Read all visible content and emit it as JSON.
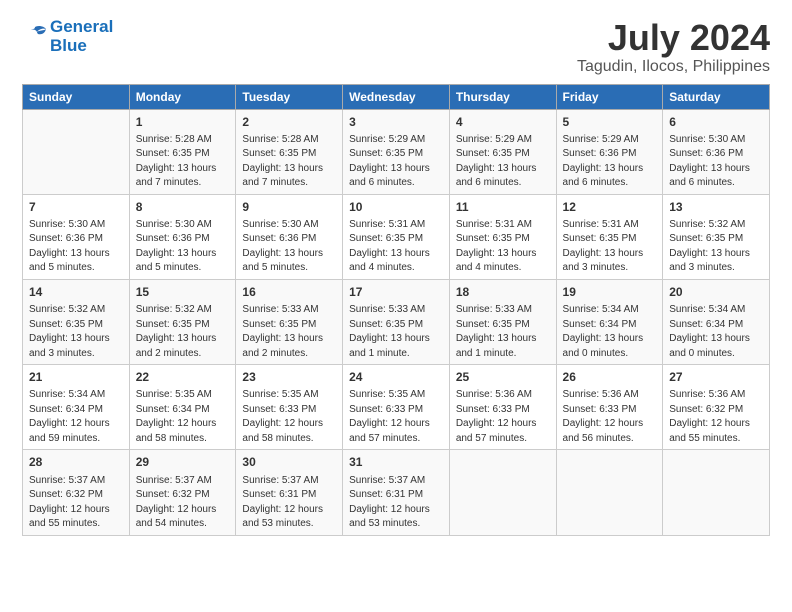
{
  "logo": {
    "line1": "General",
    "line2": "Blue"
  },
  "title": "July 2024",
  "subtitle": "Tagudin, Ilocos, Philippines",
  "headers": [
    "Sunday",
    "Monday",
    "Tuesday",
    "Wednesday",
    "Thursday",
    "Friday",
    "Saturday"
  ],
  "weeks": [
    [
      {
        "day": "",
        "info": ""
      },
      {
        "day": "1",
        "info": "Sunrise: 5:28 AM\nSunset: 6:35 PM\nDaylight: 13 hours\nand 7 minutes."
      },
      {
        "day": "2",
        "info": "Sunrise: 5:28 AM\nSunset: 6:35 PM\nDaylight: 13 hours\nand 7 minutes."
      },
      {
        "day": "3",
        "info": "Sunrise: 5:29 AM\nSunset: 6:35 PM\nDaylight: 13 hours\nand 6 minutes."
      },
      {
        "day": "4",
        "info": "Sunrise: 5:29 AM\nSunset: 6:35 PM\nDaylight: 13 hours\nand 6 minutes."
      },
      {
        "day": "5",
        "info": "Sunrise: 5:29 AM\nSunset: 6:36 PM\nDaylight: 13 hours\nand 6 minutes."
      },
      {
        "day": "6",
        "info": "Sunrise: 5:30 AM\nSunset: 6:36 PM\nDaylight: 13 hours\nand 6 minutes."
      }
    ],
    [
      {
        "day": "7",
        "info": "Sunrise: 5:30 AM\nSunset: 6:36 PM\nDaylight: 13 hours\nand 5 minutes."
      },
      {
        "day": "8",
        "info": "Sunrise: 5:30 AM\nSunset: 6:36 PM\nDaylight: 13 hours\nand 5 minutes."
      },
      {
        "day": "9",
        "info": "Sunrise: 5:30 AM\nSunset: 6:36 PM\nDaylight: 13 hours\nand 5 minutes."
      },
      {
        "day": "10",
        "info": "Sunrise: 5:31 AM\nSunset: 6:35 PM\nDaylight: 13 hours\nand 4 minutes."
      },
      {
        "day": "11",
        "info": "Sunrise: 5:31 AM\nSunset: 6:35 PM\nDaylight: 13 hours\nand 4 minutes."
      },
      {
        "day": "12",
        "info": "Sunrise: 5:31 AM\nSunset: 6:35 PM\nDaylight: 13 hours\nand 3 minutes."
      },
      {
        "day": "13",
        "info": "Sunrise: 5:32 AM\nSunset: 6:35 PM\nDaylight: 13 hours\nand 3 minutes."
      }
    ],
    [
      {
        "day": "14",
        "info": "Sunrise: 5:32 AM\nSunset: 6:35 PM\nDaylight: 13 hours\nand 3 minutes."
      },
      {
        "day": "15",
        "info": "Sunrise: 5:32 AM\nSunset: 6:35 PM\nDaylight: 13 hours\nand 2 minutes."
      },
      {
        "day": "16",
        "info": "Sunrise: 5:33 AM\nSunset: 6:35 PM\nDaylight: 13 hours\nand 2 minutes."
      },
      {
        "day": "17",
        "info": "Sunrise: 5:33 AM\nSunset: 6:35 PM\nDaylight: 13 hours\nand 1 minute."
      },
      {
        "day": "18",
        "info": "Sunrise: 5:33 AM\nSunset: 6:35 PM\nDaylight: 13 hours\nand 1 minute."
      },
      {
        "day": "19",
        "info": "Sunrise: 5:34 AM\nSunset: 6:34 PM\nDaylight: 13 hours\nand 0 minutes."
      },
      {
        "day": "20",
        "info": "Sunrise: 5:34 AM\nSunset: 6:34 PM\nDaylight: 13 hours\nand 0 minutes."
      }
    ],
    [
      {
        "day": "21",
        "info": "Sunrise: 5:34 AM\nSunset: 6:34 PM\nDaylight: 12 hours\nand 59 minutes."
      },
      {
        "day": "22",
        "info": "Sunrise: 5:35 AM\nSunset: 6:34 PM\nDaylight: 12 hours\nand 58 minutes."
      },
      {
        "day": "23",
        "info": "Sunrise: 5:35 AM\nSunset: 6:33 PM\nDaylight: 12 hours\nand 58 minutes."
      },
      {
        "day": "24",
        "info": "Sunrise: 5:35 AM\nSunset: 6:33 PM\nDaylight: 12 hours\nand 57 minutes."
      },
      {
        "day": "25",
        "info": "Sunrise: 5:36 AM\nSunset: 6:33 PM\nDaylight: 12 hours\nand 57 minutes."
      },
      {
        "day": "26",
        "info": "Sunrise: 5:36 AM\nSunset: 6:33 PM\nDaylight: 12 hours\nand 56 minutes."
      },
      {
        "day": "27",
        "info": "Sunrise: 5:36 AM\nSunset: 6:32 PM\nDaylight: 12 hours\nand 55 minutes."
      }
    ],
    [
      {
        "day": "28",
        "info": "Sunrise: 5:37 AM\nSunset: 6:32 PM\nDaylight: 12 hours\nand 55 minutes."
      },
      {
        "day": "29",
        "info": "Sunrise: 5:37 AM\nSunset: 6:32 PM\nDaylight: 12 hours\nand 54 minutes."
      },
      {
        "day": "30",
        "info": "Sunrise: 5:37 AM\nSunset: 6:31 PM\nDaylight: 12 hours\nand 53 minutes."
      },
      {
        "day": "31",
        "info": "Sunrise: 5:37 AM\nSunset: 6:31 PM\nDaylight: 12 hours\nand 53 minutes."
      },
      {
        "day": "",
        "info": ""
      },
      {
        "day": "",
        "info": ""
      },
      {
        "day": "",
        "info": ""
      }
    ]
  ]
}
